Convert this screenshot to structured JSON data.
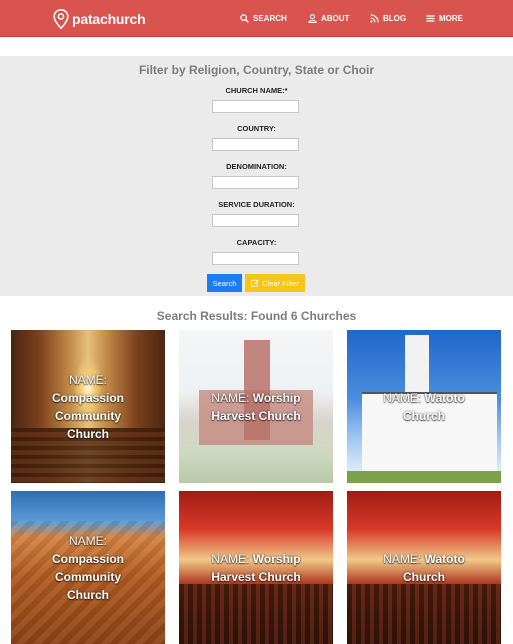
{
  "header": {
    "brand": "patachurch",
    "nav": [
      {
        "label": "SEARCH",
        "icon": "search-icon"
      },
      {
        "label": "ABOUT",
        "icon": "user-icon"
      },
      {
        "label": "BLOG",
        "icon": "rss-icon"
      },
      {
        "label": "MORE",
        "icon": "menu-icon"
      }
    ],
    "accent_color": "#d9534f"
  },
  "filter": {
    "title": "Filter by Religion, Country, State or Choir",
    "fields": [
      {
        "label": "CHURCH NAME:*",
        "value": "",
        "placeholder": ""
      },
      {
        "label": "COUNTRY:",
        "value": "",
        "placeholder": ""
      },
      {
        "label": "DENOMINATION:",
        "value": "",
        "placeholder": ""
      },
      {
        "label": "SERVICE DURATION:",
        "value": "",
        "placeholder": ""
      },
      {
        "label": "CAPACITY:",
        "value": "",
        "placeholder": ""
      }
    ],
    "search_label": "Search",
    "clear_label": "Clear Filter",
    "search_color": "#1e7cf2",
    "clear_color": "#f5c518"
  },
  "results": {
    "title": "Search Results: Found 6 Churches",
    "name_prefix": "NAME:",
    "cards": [
      {
        "name": "Compassion Community Church",
        "image": "church-aisle-photo"
      },
      {
        "name": "Worship Harvest Church",
        "image": "brick-church-photo"
      },
      {
        "name": "Watoto Church",
        "image": "white-chapel-photo"
      },
      {
        "name": "Compassion Community Church",
        "image": "wooden-roof-cross-photo"
      },
      {
        "name": "Worship Harvest Church",
        "image": "congregation-photo"
      },
      {
        "name": "Watoto Church",
        "image": "congregation-photo"
      }
    ]
  }
}
